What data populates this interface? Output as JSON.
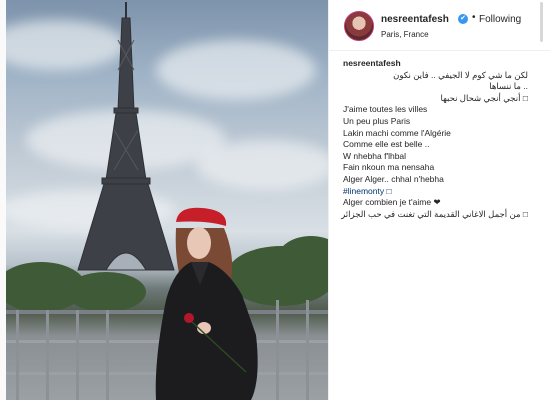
{
  "post": {
    "username": "nesreentafesh",
    "follow_label": "Following",
    "location": "Paris, France",
    "verified_mark": "✔",
    "separator": "•"
  },
  "caption": {
    "username": "nesreentafesh",
    "lines": [
      "لكن ما شي كوم لا الجيفي .. فاين نكون",
      ".. ما ننساها",
      "□ أنجي أنجي شحال نحبها",
      "J'aime toutes les villes",
      "Un peu plus Paris",
      "Lakin machi comme l'Algérie",
      "Comme elle est belle ..",
      "W nhebha f'lhbal",
      "Fain nkoun ma nensaha",
      "Alger Alger.. chhal n'hebha",
      "#linemonty □",
      "Alger combien je t'aime ❤",
      "□ من أجمل الاغاني القديمة التي تغنت في حب الجزائر"
    ]
  },
  "icons": {
    "avatar": "avatar",
    "verified": "verified-badge-icon",
    "rose": "rose-icon"
  }
}
